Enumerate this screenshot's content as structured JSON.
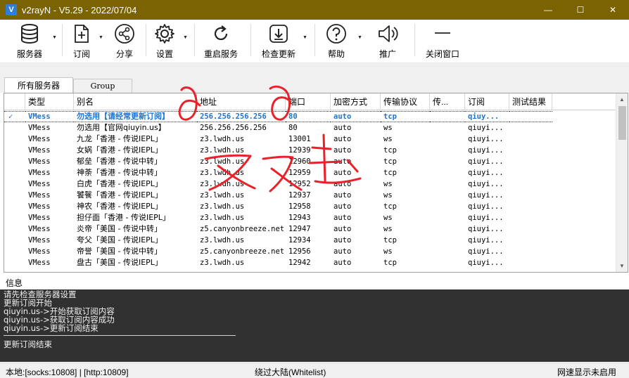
{
  "window": {
    "title": "v2rayN - V5.29 - 2022/07/04",
    "logo_letter": "V",
    "minimize": "—",
    "maximize": "☐",
    "close": "✕"
  },
  "toolbar": {
    "servers": "服务器",
    "subscribe": "订阅",
    "share": "分享",
    "settings": "设置",
    "restart": "重启服务",
    "check_update": "检查更新",
    "help": "帮助",
    "promote": "推广",
    "close_window": "关闭窗口",
    "dropdown_arrow": "▼"
  },
  "tabs": [
    {
      "label": "所有服务器"
    },
    {
      "label": "Group"
    }
  ],
  "grid": {
    "columns": [
      "类型",
      "别名",
      "地址",
      "端口",
      "加密方式",
      "传输协议",
      "传...",
      "订阅",
      "测试结果"
    ],
    "selected_mark": "✓",
    "rows": [
      {
        "type": "VMess",
        "alias": "勿选用【请经常更新订阅】",
        "address": "256.256.256.256",
        "port": "80",
        "security": "auto",
        "network": "tcp",
        "sub": "qiuy...",
        "result": ""
      },
      {
        "type": "VMess",
        "alias": "勿选用【官网qiuyin.us】",
        "address": "256.256.256.256",
        "port": "80",
        "security": "auto",
        "network": "ws",
        "sub": "qiuyi...",
        "result": ""
      },
      {
        "type": "VMess",
        "alias": "九龙「香港 - 传说IEPL」",
        "address": "z3.lwdh.us",
        "port": "13001",
        "security": "auto",
        "network": "ws",
        "sub": "qiuyi...",
        "result": ""
      },
      {
        "type": "VMess",
        "alias": "女娲「香港 - 传说IEPL」",
        "address": "z3.lwdh.us",
        "port": "12939",
        "security": "auto",
        "network": "tcp",
        "sub": "qiuyi...",
        "result": ""
      },
      {
        "type": "VMess",
        "alias": "郁垒「香港 - 传说中转」",
        "address": "z3.lwdh.us",
        "port": "12960",
        "security": "auto",
        "network": "tcp",
        "sub": "qiuyi...",
        "result": ""
      },
      {
        "type": "VMess",
        "alias": "神荼「香港 - 传说中转」",
        "address": "z3.lwdh.us",
        "port": "12959",
        "security": "auto",
        "network": "tcp",
        "sub": "qiuyi...",
        "result": ""
      },
      {
        "type": "VMess",
        "alias": "白虎「香港 - 传说IEPL」",
        "address": "z3.lwdh.us",
        "port": "12952",
        "security": "auto",
        "network": "ws",
        "sub": "qiuyi...",
        "result": ""
      },
      {
        "type": "VMess",
        "alias": "饕餮「香港 - 传说IEPL」",
        "address": "z3.lwdh.us",
        "port": "12937",
        "security": "auto",
        "network": "ws",
        "sub": "qiuyi...",
        "result": ""
      },
      {
        "type": "VMess",
        "alias": "神农「香港 - 传说IEPL」",
        "address": "z3.lwdh.us",
        "port": "12958",
        "security": "auto",
        "network": "tcp",
        "sub": "qiuyi...",
        "result": ""
      },
      {
        "type": "VMess",
        "alias": "担仔面「香港 - 传说IEPL」",
        "address": "z3.lwdh.us",
        "port": "12943",
        "security": "auto",
        "network": "ws",
        "sub": "qiuyi...",
        "result": ""
      },
      {
        "type": "VMess",
        "alias": "炎帝「美国 - 传说中转」",
        "address": "z5.canyonbreeze.net",
        "port": "12947",
        "security": "auto",
        "network": "ws",
        "sub": "qiuyi...",
        "result": ""
      },
      {
        "type": "VMess",
        "alias": "夸父「美国 - 传说IEPL」",
        "address": "z3.lwdh.us",
        "port": "12934",
        "security": "auto",
        "network": "tcp",
        "sub": "qiuyi...",
        "result": ""
      },
      {
        "type": "VMess",
        "alias": "帝誉「美国 - 传说中转」",
        "address": "z5.canyonbreeze.net",
        "port": "12956",
        "security": "auto",
        "network": "ws",
        "sub": "qiuyi...",
        "result": ""
      },
      {
        "type": "VMess",
        "alias": "盘古「美国 - 传说IEPL」",
        "address": "z3.lwdh.us",
        "port": "12942",
        "security": "auto",
        "network": "tcp",
        "sub": "qiuyi...",
        "result": ""
      }
    ]
  },
  "info": {
    "label": "信息",
    "log_lines": [
      "请先检查服务器设置",
      "更新订阅开始",
      "qiuyin.us->开始获取订阅内容",
      "qiuyin.us->获取订阅内容成功",
      "qiuyin.us->更新订阅结束"
    ],
    "log_end": "更新订阅结束"
  },
  "status": {
    "local": "本地:[socks:10808] | [http:10809]",
    "routing": "绕过大陆(Whitelist)",
    "speed": "网速显示未启用"
  },
  "annotation": {
    "handwritten": "双击",
    "color": "#e8222a"
  }
}
